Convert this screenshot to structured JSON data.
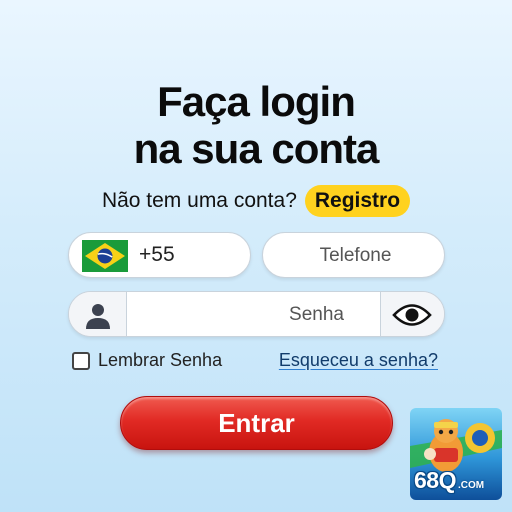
{
  "header": {
    "title_line1": "Faça login",
    "title_line2": "na sua conta"
  },
  "signup": {
    "prompt": "Não tem uma conta?",
    "register_label": "Registro"
  },
  "form": {
    "country_flag": "brazil-flag-icon",
    "country_code": "+55",
    "phone_placeholder": "Telefone",
    "password_placeholder": "Senha",
    "remember_label": "Lembrar Senha",
    "remember_checked": false,
    "forgot_label": "Esqueceu a senha?",
    "submit_label": "Entrar"
  },
  "promo": {
    "brand": "68Q",
    "domain": ".COM"
  },
  "colors": {
    "accent_yellow": "#ffd21f",
    "submit_red": "#e12a24",
    "background": "#d4ecfb",
    "link_underline": "#2f7fd0"
  }
}
